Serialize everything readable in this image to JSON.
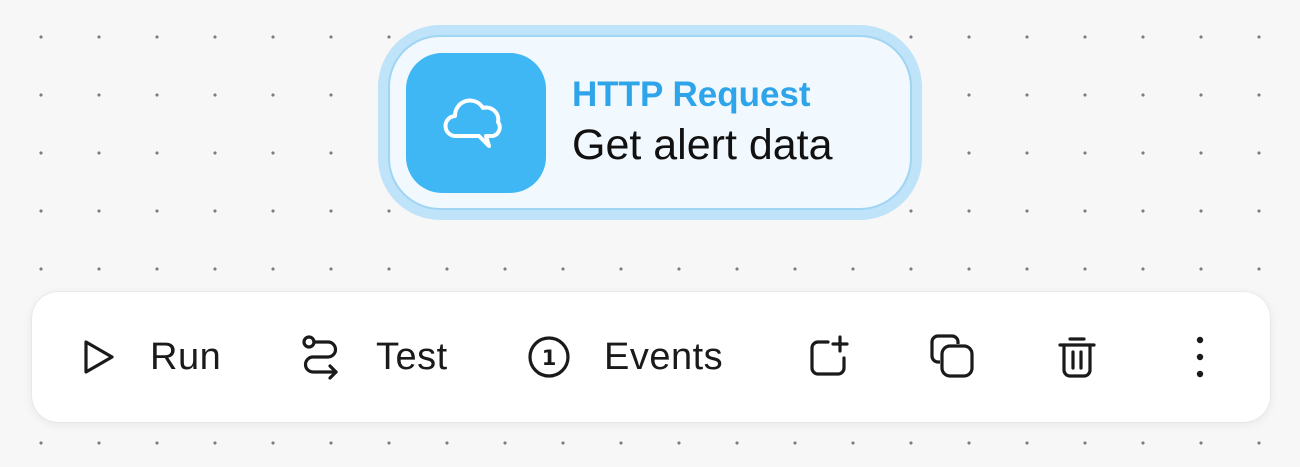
{
  "node": {
    "type_label": "HTTP Request",
    "name": "Get alert data",
    "icon": "cloud-chat-icon",
    "accent_color": "#3fb7f5",
    "selected": true
  },
  "toolbar": {
    "run": {
      "label": "Run",
      "icon": "play-icon"
    },
    "test": {
      "label": "Test",
      "icon": "route-icon"
    },
    "events": {
      "label": "Events",
      "icon": "events-count-icon",
      "count": "1"
    },
    "add": {
      "icon": "add-square-icon"
    },
    "duplicate": {
      "icon": "copy-icon"
    },
    "delete": {
      "icon": "trash-icon"
    },
    "more": {
      "icon": "more-vertical-icon"
    }
  }
}
